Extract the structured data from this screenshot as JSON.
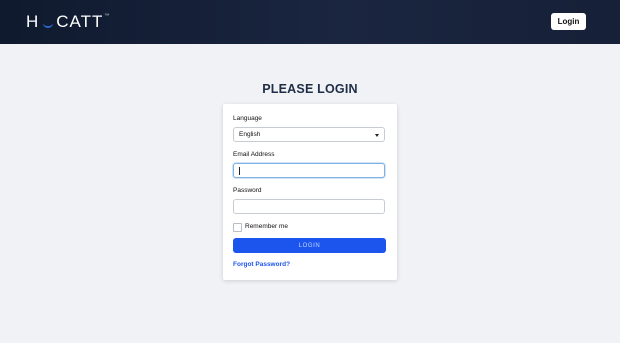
{
  "header": {
    "logo_part1": "H",
    "logo_part2": "CATT",
    "logo_tm": "™",
    "login_button": "Login"
  },
  "page": {
    "title": "PLEASE LOGIN"
  },
  "form": {
    "language_label": "Language",
    "language_value": "English",
    "email_label": "Email Address",
    "email_value": "",
    "password_label": "Password",
    "password_value": "",
    "remember_label": "Remember me",
    "remember_checked": false,
    "submit_label": "LOGIN",
    "forgot_label": "Forgot Password?"
  },
  "colors": {
    "header_bg": "#162037",
    "accent": "#1b55ee",
    "page_bg": "#f1f2f5"
  }
}
